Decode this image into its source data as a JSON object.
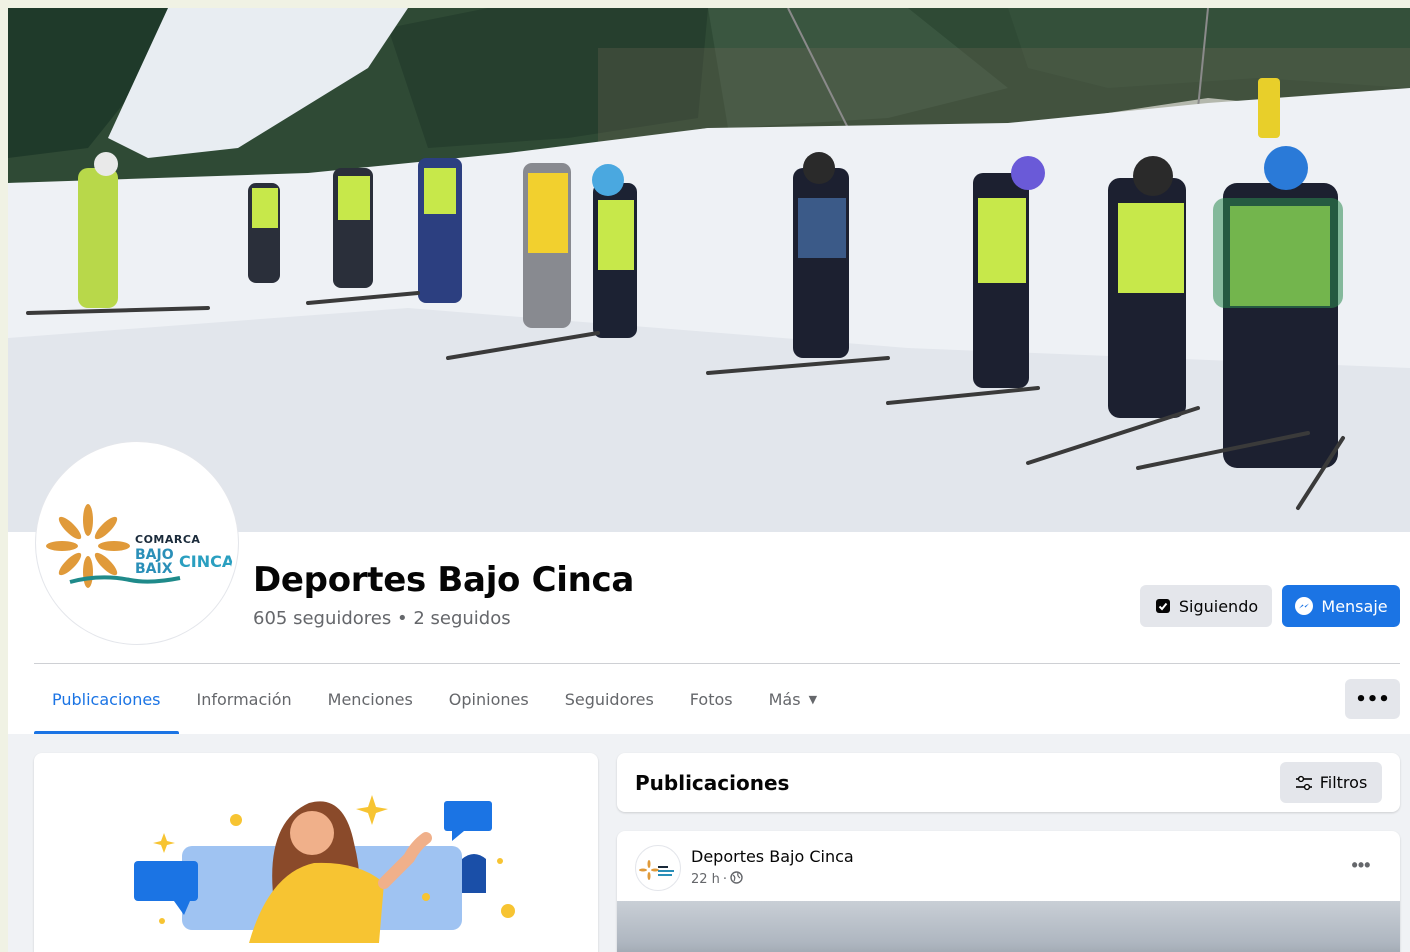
{
  "profile": {
    "name": "Deportes Bajo Cinca",
    "followers_text": "605 seguidores • 2 seguidos",
    "logo": {
      "line1": "COMARCA",
      "line2": "BAJO",
      "line3": "BAIX",
      "line4": "CINCA"
    }
  },
  "actions": {
    "following_label": "Siguiendo",
    "message_label": "Mensaje",
    "following_icon": "bookmark-check-icon",
    "message_icon": "messenger-icon"
  },
  "tabs": [
    {
      "label": "Publicaciones",
      "active": true
    },
    {
      "label": "Información"
    },
    {
      "label": "Menciones"
    },
    {
      "label": "Opiniones"
    },
    {
      "label": "Seguidores"
    },
    {
      "label": "Fotos"
    },
    {
      "label": "Más"
    }
  ],
  "more_tabs_icon": "more-dots-icon",
  "posts_section": {
    "title": "Publicaciones",
    "filters_label": "Filtros"
  },
  "post": {
    "author": "Deportes Bajo Cinca",
    "time": "22 h",
    "separator": "·",
    "audience_icon": "globe-icon"
  },
  "colors": {
    "accent": "#1b74e4",
    "button_gray": "#e4e6eb",
    "text_secondary": "#65676b",
    "page_bg": "#f0f2f5",
    "vest_green": "#c7e84a"
  }
}
